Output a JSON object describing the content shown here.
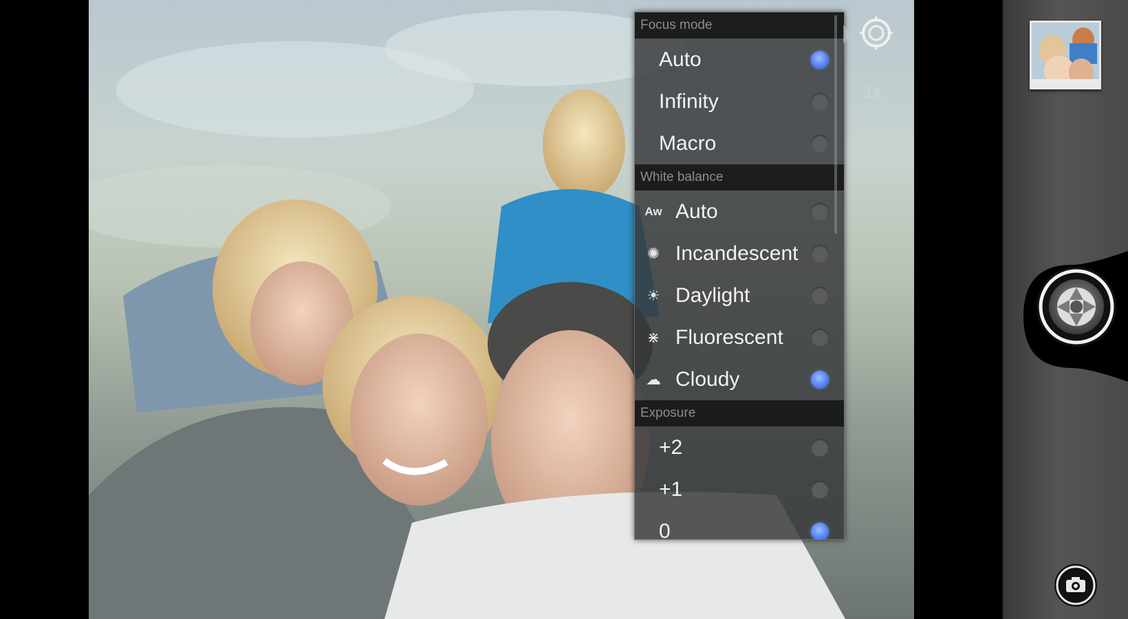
{
  "popup": {
    "sections": [
      {
        "title": "Focus mode",
        "options": [
          {
            "label": "Auto",
            "selected": true
          },
          {
            "label": "Infinity",
            "selected": false
          },
          {
            "label": "Macro",
            "selected": false
          }
        ]
      },
      {
        "title": "White balance",
        "options": [
          {
            "label": "Auto",
            "icon": "auto-wb-icon",
            "glyph": "Aw",
            "selected": false
          },
          {
            "label": "Incandescent",
            "icon": "incandescent-icon",
            "glyph": "✺",
            "selected": false
          },
          {
            "label": "Daylight",
            "icon": "daylight-icon",
            "glyph": "☀",
            "selected": false
          },
          {
            "label": "Fluorescent",
            "icon": "fluorescent-icon",
            "glyph": "⋇",
            "selected": false
          },
          {
            "label": "Cloudy",
            "icon": "cloudy-icon",
            "glyph": "☁",
            "selected": true
          }
        ]
      },
      {
        "title": "Exposure",
        "options": [
          {
            "label": "+2",
            "selected": false
          },
          {
            "label": "+1",
            "selected": false
          },
          {
            "label": "0",
            "selected": true
          }
        ]
      }
    ]
  },
  "zoom": {
    "label": "1x"
  },
  "colors": {
    "accent_radio": "#4f7ef2",
    "popup_bg": "#343638",
    "header_bg": "#141414"
  }
}
